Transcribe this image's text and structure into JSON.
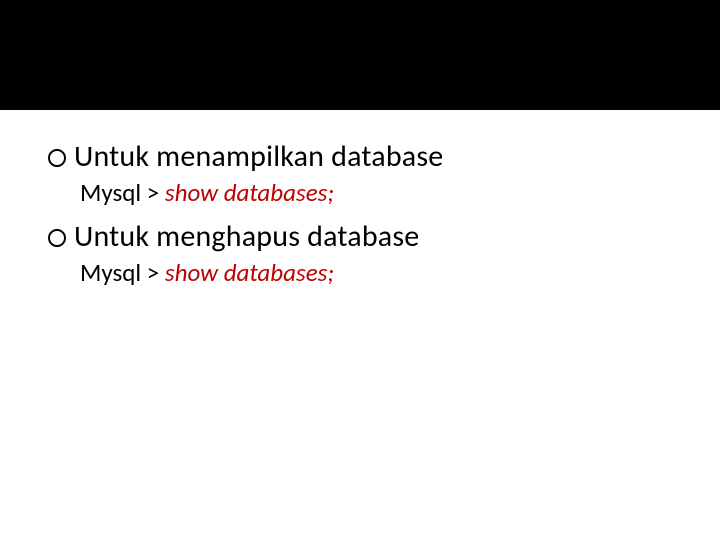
{
  "items": [
    {
      "title": "Untuk menampilkan database",
      "prompt": "Mysql > ",
      "command": "show databases;"
    },
    {
      "title": "Untuk menghapus database",
      "prompt": "Mysql > ",
      "command": "show databases;"
    }
  ]
}
